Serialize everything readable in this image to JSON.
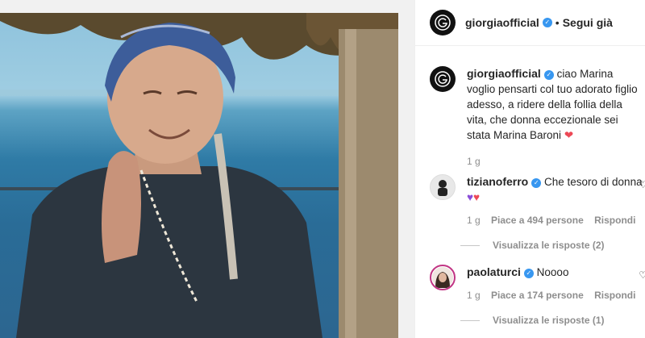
{
  "post": {
    "author": "giorgiaofficial",
    "follow_status": "Segui già",
    "separator": "•"
  },
  "caption": {
    "author": "giorgiaofficial",
    "text": "ciao Marina voglio pensarti col tuo adorato figlio adesso, a ridere della follia della vita, che donna eccezionale sei stata Marina Baroni",
    "emoji": "❤",
    "time": "1 g"
  },
  "comments": [
    {
      "author": "tizianoferro",
      "text": "Che tesoro di donna",
      "emoji_a": "♥",
      "emoji_b": "♥",
      "time": "1 g",
      "likes": "Piace a 494 persone",
      "reply_label": "Rispondi",
      "view_replies": "Visualizza le risposte (2)"
    },
    {
      "author": "paolaturci",
      "text": "Noooo",
      "time": "1 g",
      "likes": "Piace a 174 persone",
      "reply_label": "Rispondi",
      "view_replies": "Visualizza le risposte (1)"
    }
  ],
  "colors": {
    "verified": "#3897f0",
    "heart_red": "#ed4956",
    "heart_purple": "#8a4dd8"
  }
}
